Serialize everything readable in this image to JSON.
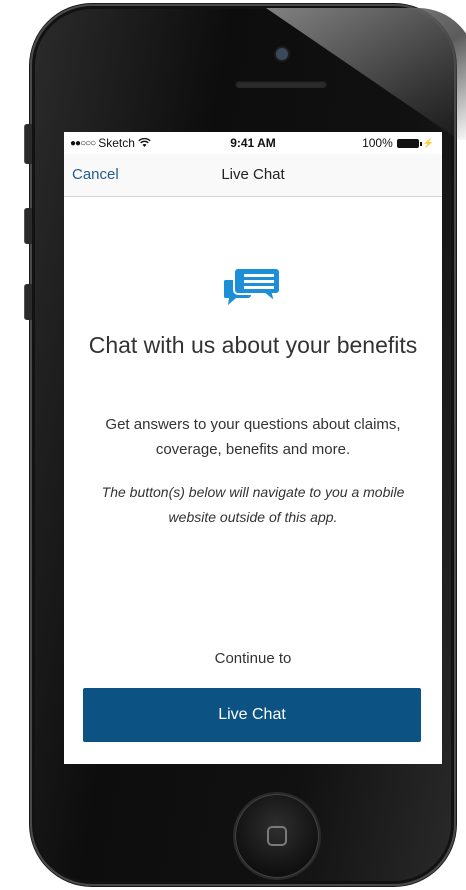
{
  "status_bar": {
    "carrier": "Sketch",
    "time": "9:41 AM",
    "battery_percent": "100%"
  },
  "nav": {
    "cancel_label": "Cancel",
    "title": "Live Chat"
  },
  "content": {
    "icon": "chat-bubbles-icon",
    "headline": "Chat with us about your benefits",
    "description": "Get answers to your questions about claims, coverage, benefits and more.",
    "note": "The button(s) below will navigate to you a mobile website outside of this app.",
    "continue_label": "Continue to",
    "button_label": "Live Chat"
  },
  "colors": {
    "accent": "#0c5283",
    "link": "#1e5d8e",
    "icon": "#1c8fd8"
  }
}
